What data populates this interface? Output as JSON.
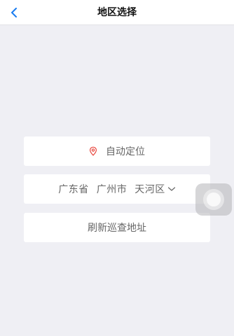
{
  "header": {
    "title": "地区选择",
    "back_icon": "chevron-left-icon",
    "accent_color": "#1a7cf0"
  },
  "locate": {
    "label": "自动定位",
    "icon": "location-pin-icon",
    "icon_color": "#e8453c"
  },
  "region": {
    "province": "广东省",
    "city": "广州市",
    "district": "天河区",
    "icon": "chevron-down-icon"
  },
  "refresh": {
    "label": "刷新巡查地址"
  },
  "assistive_touch": {
    "icon": "assistive-touch-icon"
  }
}
